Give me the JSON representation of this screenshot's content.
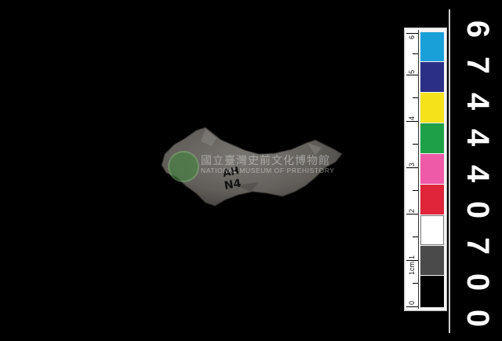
{
  "watermark": {
    "org_zh": "國立臺灣史前文化博物館",
    "org_en": "NATIONAL MUSEUM OF PREHISTORY"
  },
  "artifact": {
    "marking_line1": "AH",
    "marking_line2": "N4",
    "stone_color": "#6b6966"
  },
  "scale_card": {
    "unit": "1cm",
    "numbers": [
      "0",
      "1",
      "2",
      "3",
      "4",
      "5",
      "6"
    ],
    "swatches": [
      "#000000",
      "#4a4a4a",
      "#ffffff",
      "#e0243a",
      "#ee5aa8",
      "#1ea046",
      "#f5e21a",
      "#2b2f86",
      "#1aa0d8"
    ]
  },
  "catalog_number": {
    "digits": [
      "0",
      "0",
      "7",
      "0",
      "4",
      "4",
      "4",
      "7",
      "6"
    ]
  }
}
